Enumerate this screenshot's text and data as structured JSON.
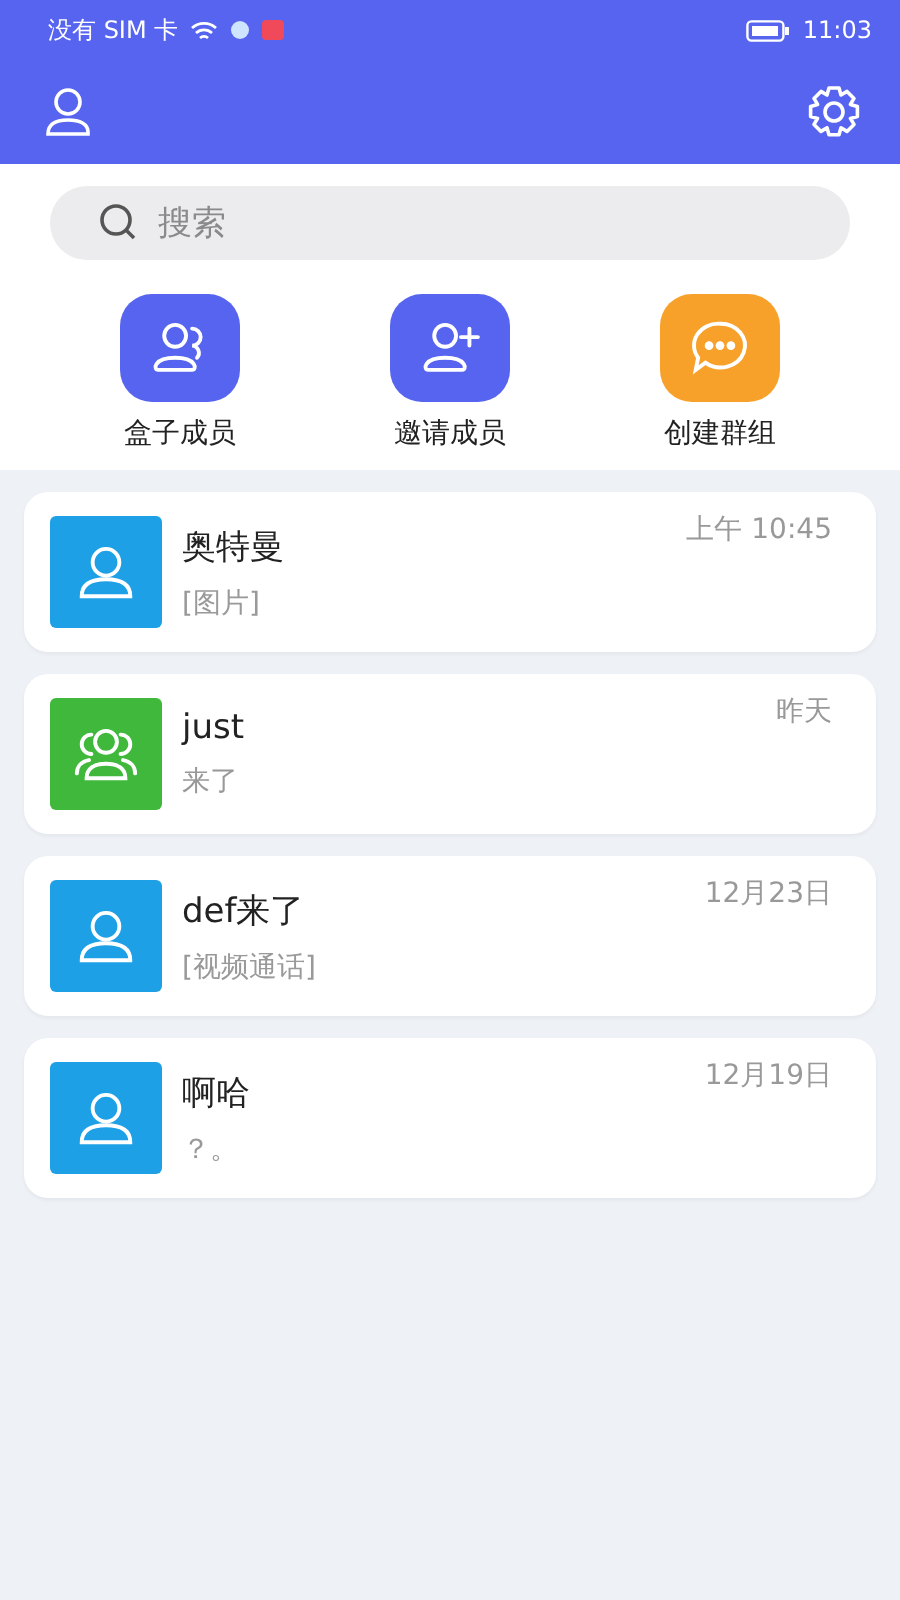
{
  "status_bar": {
    "carrier": "没有 SIM 卡",
    "time": "11:03"
  },
  "search": {
    "placeholder": "搜索"
  },
  "actions": [
    {
      "label": "盒子成员",
      "kind": "members",
      "color": "#5664f0"
    },
    {
      "label": "邀请成员",
      "kind": "invite",
      "color": "#5664f0"
    },
    {
      "label": "创建群组",
      "kind": "chat",
      "color": "#f7a12a"
    }
  ],
  "chats": [
    {
      "name": "奥特曼",
      "preview": "[图片]",
      "time": "上午 10:45",
      "kind": "person",
      "color": "#1ea0e6"
    },
    {
      "name": "just",
      "preview": "来了",
      "time": "昨天",
      "kind": "group",
      "color": "#3fb83c"
    },
    {
      "name": "def来了",
      "preview": "[视频通话]",
      "time": "12月23日",
      "kind": "person",
      "color": "#1ea0e6"
    },
    {
      "name": "啊哈",
      "preview": "？。",
      "time": "12月19日",
      "kind": "person",
      "color": "#1ea0e6"
    }
  ]
}
